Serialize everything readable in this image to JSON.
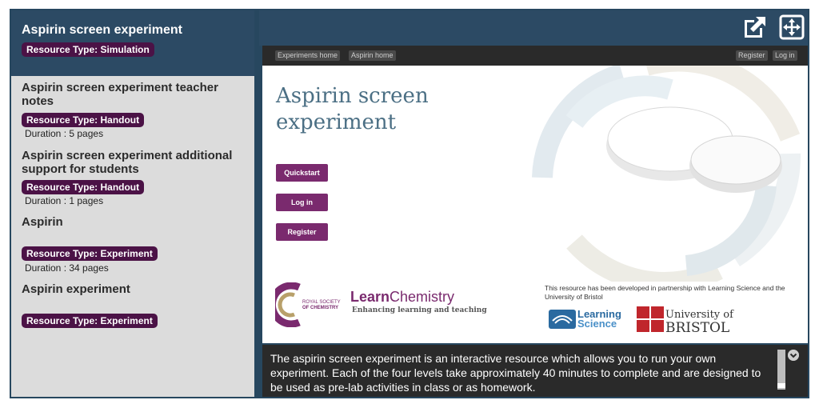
{
  "sidebar": {
    "items": [
      {
        "title": "Aspirin screen experiment",
        "type": "Resource Type: Simulation"
      },
      {
        "title": "Aspirin screen experiment teacher notes",
        "type": "Resource Type: Handout",
        "duration": "Duration : 5 pages"
      },
      {
        "title": "Aspirin screen experiment additional support for students",
        "type": "Resource Type: Handout",
        "duration": "Duration : 1 pages"
      },
      {
        "title": "Aspirin",
        "type": "Resource Type: Experiment",
        "duration": "Duration : 34 pages"
      },
      {
        "title": "Aspirin experiment",
        "type": "Resource Type: Experiment"
      }
    ]
  },
  "topbar": {
    "icons": [
      "external-link-icon",
      "fullscreen-icon"
    ]
  },
  "sim": {
    "nav": {
      "experiments_home": "Experiments home",
      "aspirin_home": "Aspirin home",
      "register": "Register",
      "login": "Log in"
    },
    "title_line1": "Aspirin screen",
    "title_line2": "experiment",
    "buttons": {
      "quickstart": "Quickstart",
      "login": "Log in",
      "register": "Register"
    },
    "rsc_line1": "ROYAL SOCIETY",
    "rsc_line2": "OF CHEMISTRY",
    "lc_part1": "Learn",
    "lc_part2": "Chemistry",
    "lc_sub": "Enhancing learning and teaching",
    "partner_text": "This resource has been developed in partnership with Learning Science and the University of Bristol",
    "ls_line1": "Learning",
    "ls_line2": "Science",
    "bristol_line1": "University of",
    "bristol_line2": "BRISTOL"
  },
  "description": "The aspirin screen experiment is an interactive resource which allows you to run your own experiment. Each of the four levels take approximately 40 minutes to complete and are designed to be used as pre-lab activities in class or as homework.",
  "colors": {
    "nav_blue": "#2c4a64",
    "badge_purple": "#4b1246",
    "button_purple": "#7a2a6e"
  }
}
